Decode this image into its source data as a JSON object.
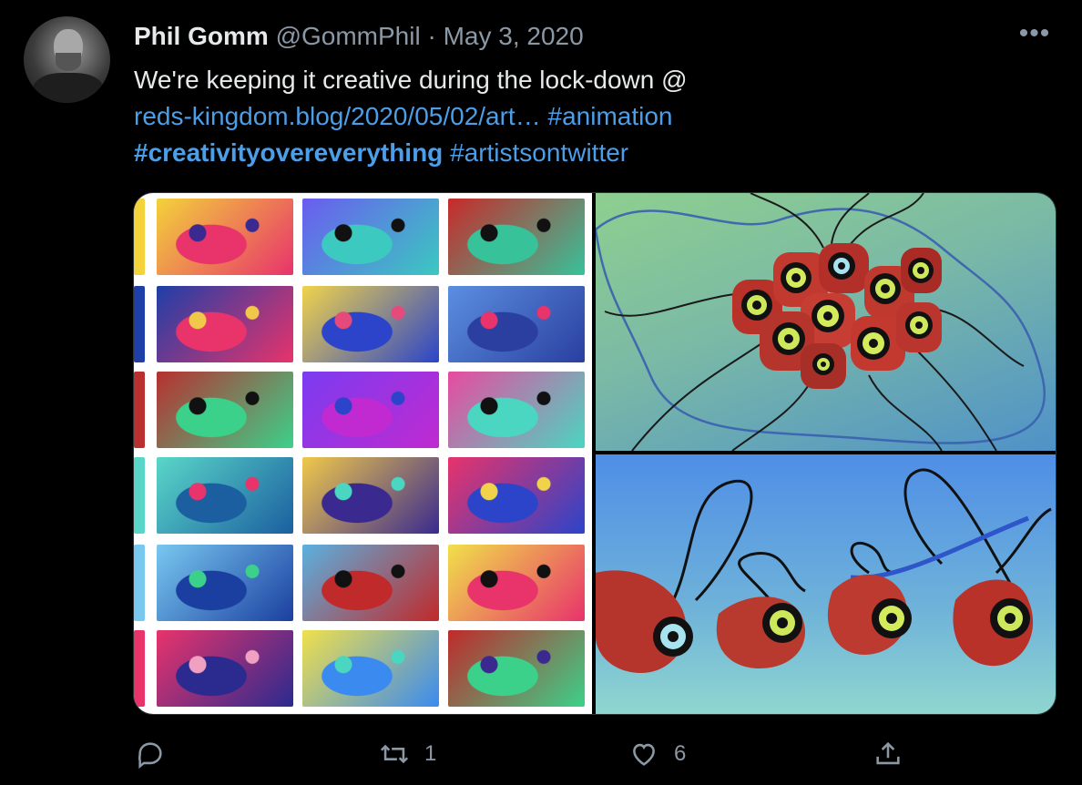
{
  "tweet": {
    "display_name": "Phil Gomm",
    "handle": "@GommPhil",
    "separator": "·",
    "date": "May 3, 2020",
    "more_label": "•••",
    "text_plain": "We're keeping it creative during the lock-down @",
    "link": "reds-kingdom.blog/2020/05/02/art…",
    "hashtag_1": "#animation",
    "hashtag_2": "#creativityovereverything",
    "hashtag_3": "#artistsontwitter"
  },
  "actions": {
    "reply_icon": "speech-bubble-icon",
    "retweet_icon": "retweet-arrows-icon",
    "retweet_count": "1",
    "like_icon": "heart-icon",
    "like_count": "6",
    "share_icon": "share-upload-icon"
  },
  "colors": {
    "background": "#000000",
    "text": "#e7e9ea",
    "muted": "#8b98a5",
    "link": "#4c9ee8"
  }
}
